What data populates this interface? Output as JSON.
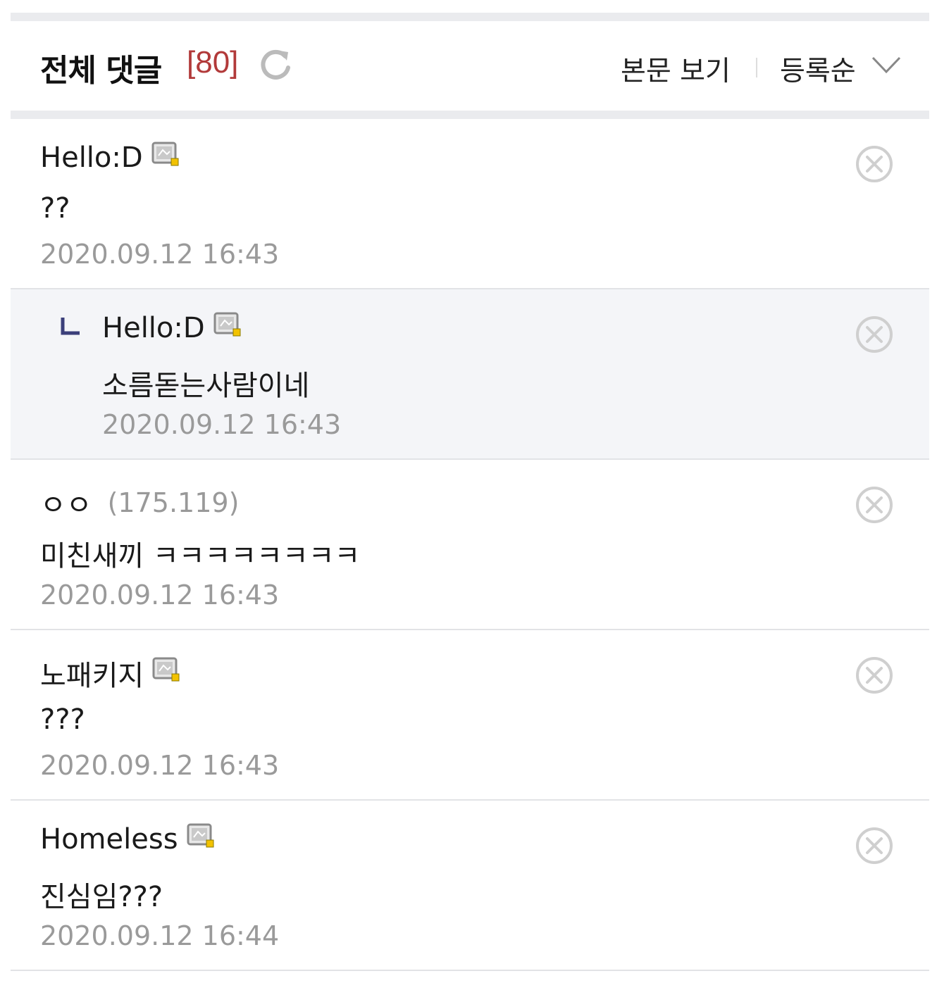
{
  "header": {
    "title": "전체 댓글",
    "count": "[80]",
    "view_body": "본문 보기",
    "sort_label": "등록순"
  },
  "icons": {
    "refresh": "refresh-icon",
    "sort_chevron": "chevron-down-icon",
    "member": "member-badge-icon",
    "delete": "delete-circle-x-icon",
    "reply_arrow": "reply-arrow-icon"
  },
  "colors": {
    "count": "#b23a3a",
    "reply_background": "#f4f5f8",
    "separator": "#eaebee",
    "date": "#9a9a9a"
  },
  "comments": [
    {
      "author": "Hello:D",
      "ip": "",
      "member": true,
      "reply": false,
      "text": "??",
      "date": "2020.09.12 16:43"
    },
    {
      "author": "Hello:D",
      "ip": "",
      "member": true,
      "reply": true,
      "text": "소름돋는사람이네",
      "date": "2020.09.12 16:43"
    },
    {
      "author": "ㅇㅇ",
      "ip": "(175.119)",
      "member": false,
      "reply": false,
      "text": "미친새끼 ㅋㅋㅋㅋㅋㅋㅋㅋ",
      "date": "2020.09.12 16:43"
    },
    {
      "author": "노패키지",
      "ip": "",
      "member": true,
      "reply": false,
      "text": "???",
      "date": "2020.09.12 16:43"
    },
    {
      "author": "Homeless",
      "ip": "",
      "member": true,
      "reply": false,
      "text": "진심임???",
      "date": "2020.09.12 16:44"
    }
  ]
}
